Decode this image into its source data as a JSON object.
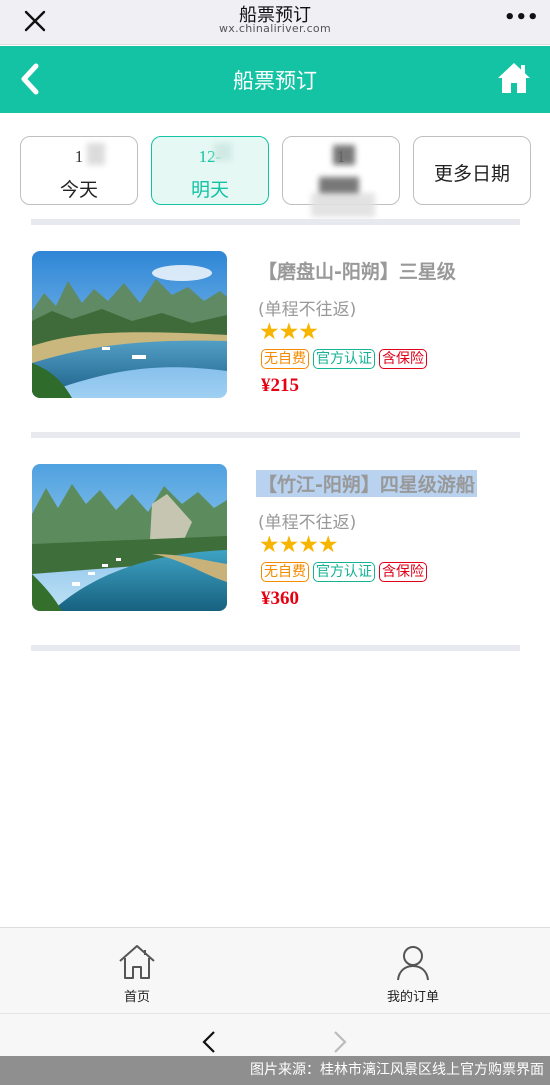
{
  "wechat": {
    "title": "船票预订",
    "url": "wx.chinaliriver.com",
    "more": "•••"
  },
  "header": {
    "title": "船票预订",
    "color": "#13c3a4"
  },
  "dates": [
    {
      "date": "1",
      "weekday": "今天",
      "active": false
    },
    {
      "date": "12-",
      "weekday": "明天",
      "active": true
    },
    {
      "date": "1",
      "weekday": "",
      "active": false
    }
  ],
  "more_dates_label": "更多日期",
  "tickets": [
    {
      "title": "【磨盘山-阳朔】三星级",
      "subtitle": "(单程不往返)",
      "rating": 3,
      "stars": "★★★",
      "badges": [
        "无自费",
        "官方认证",
        "含保险"
      ],
      "price": "¥215"
    },
    {
      "title": "【竹江-阳朔】四星级游船",
      "subtitle": "(单程不往返)",
      "rating": 4,
      "stars": "★★★★",
      "badges": [
        "无自费",
        "官方认证",
        "含保险"
      ],
      "price": "¥360"
    }
  ],
  "tabbar": {
    "home": "首页",
    "orders": "我的订单"
  },
  "caption": "图片来源：桂林市漓江风景区线上官方购票界面"
}
